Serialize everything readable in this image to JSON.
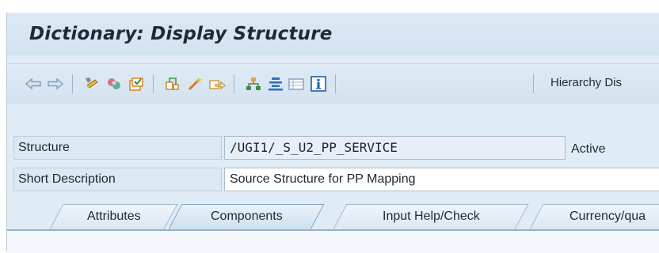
{
  "window": {
    "title": "Dictionary: Display Structure"
  },
  "toolbar": {
    "buttons": [
      {
        "name": "back-arrow-icon"
      },
      {
        "name": "forward-arrow-icon"
      },
      {
        "name": "display-change-icon"
      },
      {
        "name": "other-object-icon"
      },
      {
        "name": "check-icon"
      },
      {
        "name": "activate-icon"
      },
      {
        "name": "where-used-icon"
      },
      {
        "name": "navigate-icon"
      },
      {
        "name": "object-list-icon"
      },
      {
        "name": "hierarchy-icon"
      },
      {
        "name": "documentation-icon"
      },
      {
        "name": "table-icon"
      },
      {
        "name": "info-icon"
      }
    ],
    "hierarchy_display_label": "Hierarchy Dis"
  },
  "form": {
    "structure_label": "Structure",
    "structure_value": "/UGI1/_S_U2_PP_SERVICE",
    "status": "Active",
    "short_description_label": "Short Description",
    "short_description_value": "Source Structure for PP Mapping"
  },
  "tabs": [
    {
      "label": "Attributes",
      "active": false
    },
    {
      "label": "Components",
      "active": true
    },
    {
      "label": "Input Help/Check",
      "active": false
    },
    {
      "label": "Currency/qua",
      "active": false
    }
  ],
  "colors": {
    "background": "#dfebf5",
    "accent": "#0b6dbd",
    "tab_border": "#9fb5c9",
    "field_bg_display": "#e7eef5",
    "field_bg_input": "#ffffff"
  }
}
